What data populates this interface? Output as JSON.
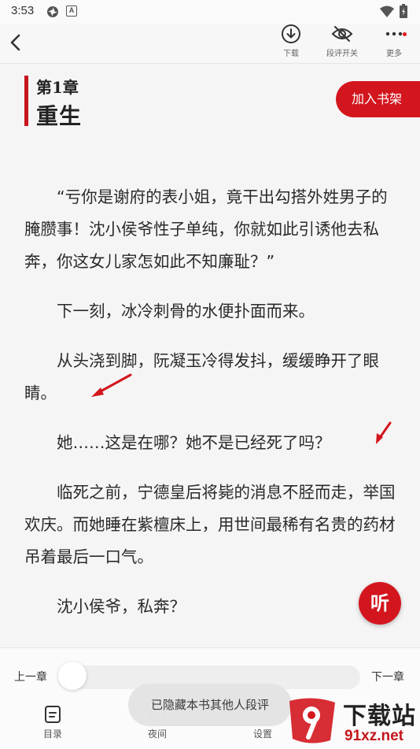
{
  "status_bar": {
    "time": "3:53",
    "app_badge": "A"
  },
  "toolbar": {
    "back_icon": "chevron-left-icon",
    "download_label": "下载",
    "comment_toggle_label": "段评开关",
    "more_label": "更多"
  },
  "chapter": {
    "number": "第1章",
    "title": "重生"
  },
  "shelf_button": "加入书架",
  "content": {
    "paragraphs": [
      "“亏你是谢府的表小姐，竟干出勾搭外姓男子的腌臜事！沈小侯爷性子单纯，你就如此引诱他去私奔，你这女儿家怎如此不知廉耻？”",
      "下一刻，冰冷刺骨的水便扑面而来。",
      "从头浇到脚，阮凝玉冷得发抖，缓缓睁开了眼睛。",
      "她……这是在哪？她不是已经死了吗？",
      "临死之前，宁德皇后将毙的消息不胫而走，举国欢庆。而她睡在紫檀床上，用世间最稀有名贵的药材吊着最后一口气。",
      "沈小侯爷，私奔？"
    ]
  },
  "listen_button": "听",
  "bottom": {
    "prev_chapter": "上一章",
    "next_chapter": "下一章",
    "progress": 0.0,
    "nav": {
      "toc": "目录",
      "night": "夜间",
      "settings": "设置"
    }
  },
  "toast": "已隐藏本书其他人段评",
  "watermark": {
    "title": "下载站",
    "domain": "91xz.net"
  },
  "colors": {
    "accent": "#d3161e",
    "background": "#f5f5f5"
  }
}
